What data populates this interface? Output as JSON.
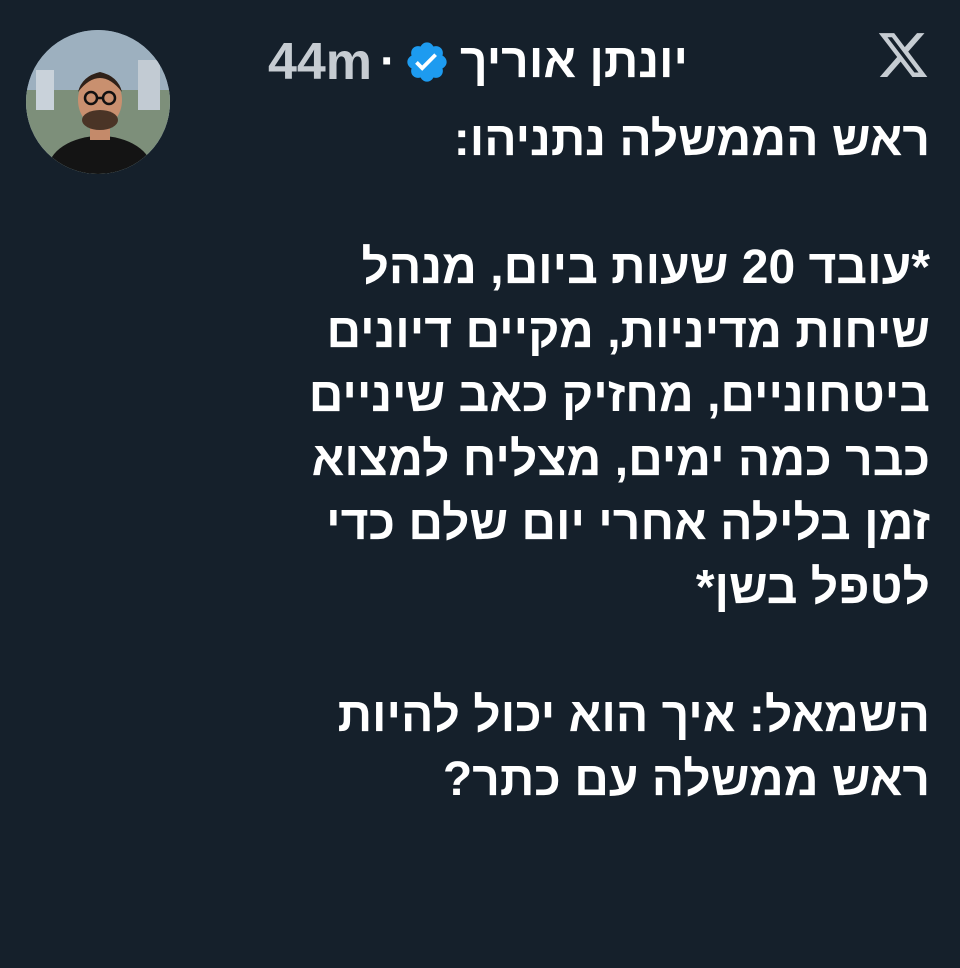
{
  "tweet": {
    "author_name": "יונתן אוריך",
    "verified": true,
    "separator": "·",
    "timestamp": "44m",
    "platform_icon": "x-logo-icon",
    "avatar_icon": "user-avatar",
    "lines": [
      "ראש הממשלה נתניהו:",
      "",
      "*עובד 20 שעות ביום, מנהל",
      "שיחות מדיניות, מקיים דיונים",
      "ביטחוניים, מחזיק כאב שיניים",
      "כבר כמה ימים, מצליח למצוא",
      "זמן בלילה אחרי יום שלם כדי",
      "לטפל בשן*",
      "",
      "השמאל: איך הוא יכול להיות",
      "ראש ממשלה עם כתר?"
    ]
  },
  "colors": {
    "background": "#15202b",
    "text": "#ffffff",
    "timestamp": "#c6ccd2",
    "verified_badge": "#1d9bf0"
  }
}
